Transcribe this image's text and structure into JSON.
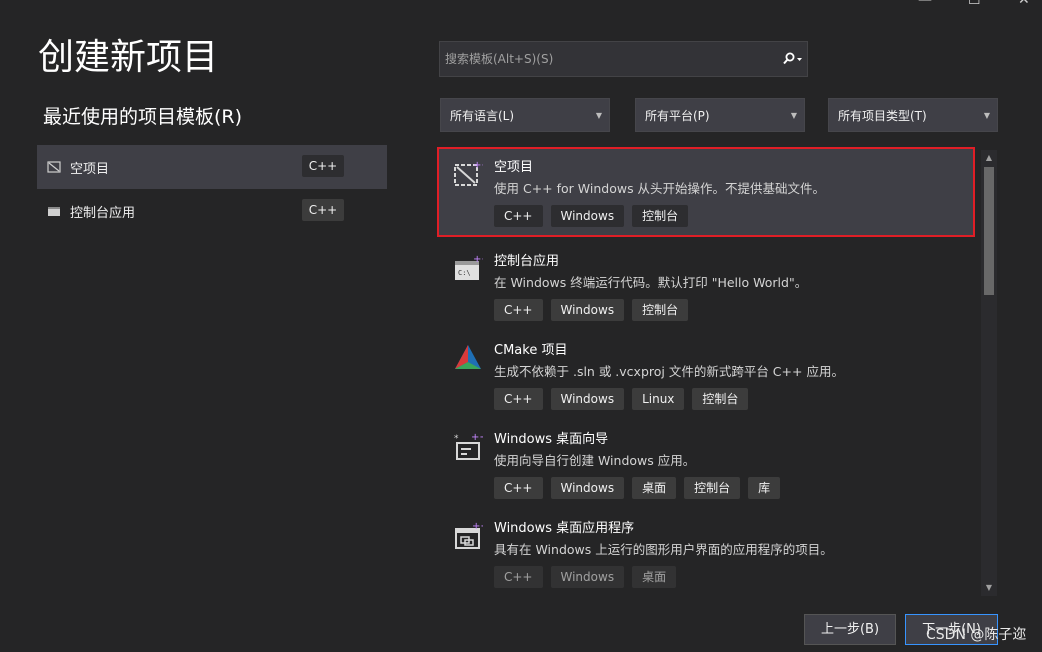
{
  "window": {
    "minimize_glyph": "—",
    "maximize_glyph": "☐",
    "close_glyph": "✕"
  },
  "page_title": "创建新项目",
  "recent": {
    "title": "最近使用的项目模板(R)",
    "items": [
      {
        "label": "空项目",
        "lang": "C++",
        "icon": "empty-project-icon"
      },
      {
        "label": "控制台应用",
        "lang": "C++",
        "icon": "console-app-icon"
      }
    ]
  },
  "search": {
    "placeholder": "搜索模板(Alt+S)(S)",
    "value": ""
  },
  "filters": {
    "language": "所有语言(L)",
    "platform": "所有平台(P)",
    "project_type": "所有项目类型(T)"
  },
  "templates": [
    {
      "name": "空项目",
      "description": "使用 C++ for Windows 从头开始操作。不提供基础文件。",
      "tags": [
        "C++",
        "Windows",
        "控制台"
      ],
      "icon": "empty-project-icon"
    },
    {
      "name": "控制台应用",
      "description": "在 Windows 终端运行代码。默认打印 \"Hello World\"。",
      "tags": [
        "C++",
        "Windows",
        "控制台"
      ],
      "icon": "console-app-icon"
    },
    {
      "name": "CMake 项目",
      "description": "生成不依赖于 .sln 或 .vcxproj 文件的新式跨平台 C++ 应用。",
      "tags": [
        "C++",
        "Windows",
        "Linux",
        "控制台"
      ],
      "icon": "cmake-icon"
    },
    {
      "name": "Windows 桌面向导",
      "description": "使用向导自行创建 Windows 应用。",
      "tags": [
        "C++",
        "Windows",
        "桌面",
        "控制台",
        "库"
      ],
      "icon": "wizard-icon"
    },
    {
      "name": "Windows 桌面应用程序",
      "description": "具有在 Windows 上运行的图形用户界面的应用程序的项目。",
      "tags": [
        "C++",
        "Windows",
        "桌面"
      ],
      "icon": "desktop-app-icon"
    }
  ],
  "buttons": {
    "back": "上一步(B)",
    "next": "下一步(N)"
  },
  "watermark": "CSDN @陈子迩",
  "colors": {
    "selection_border": "#e01e26",
    "background": "#252526",
    "accent": "#3794ff"
  }
}
